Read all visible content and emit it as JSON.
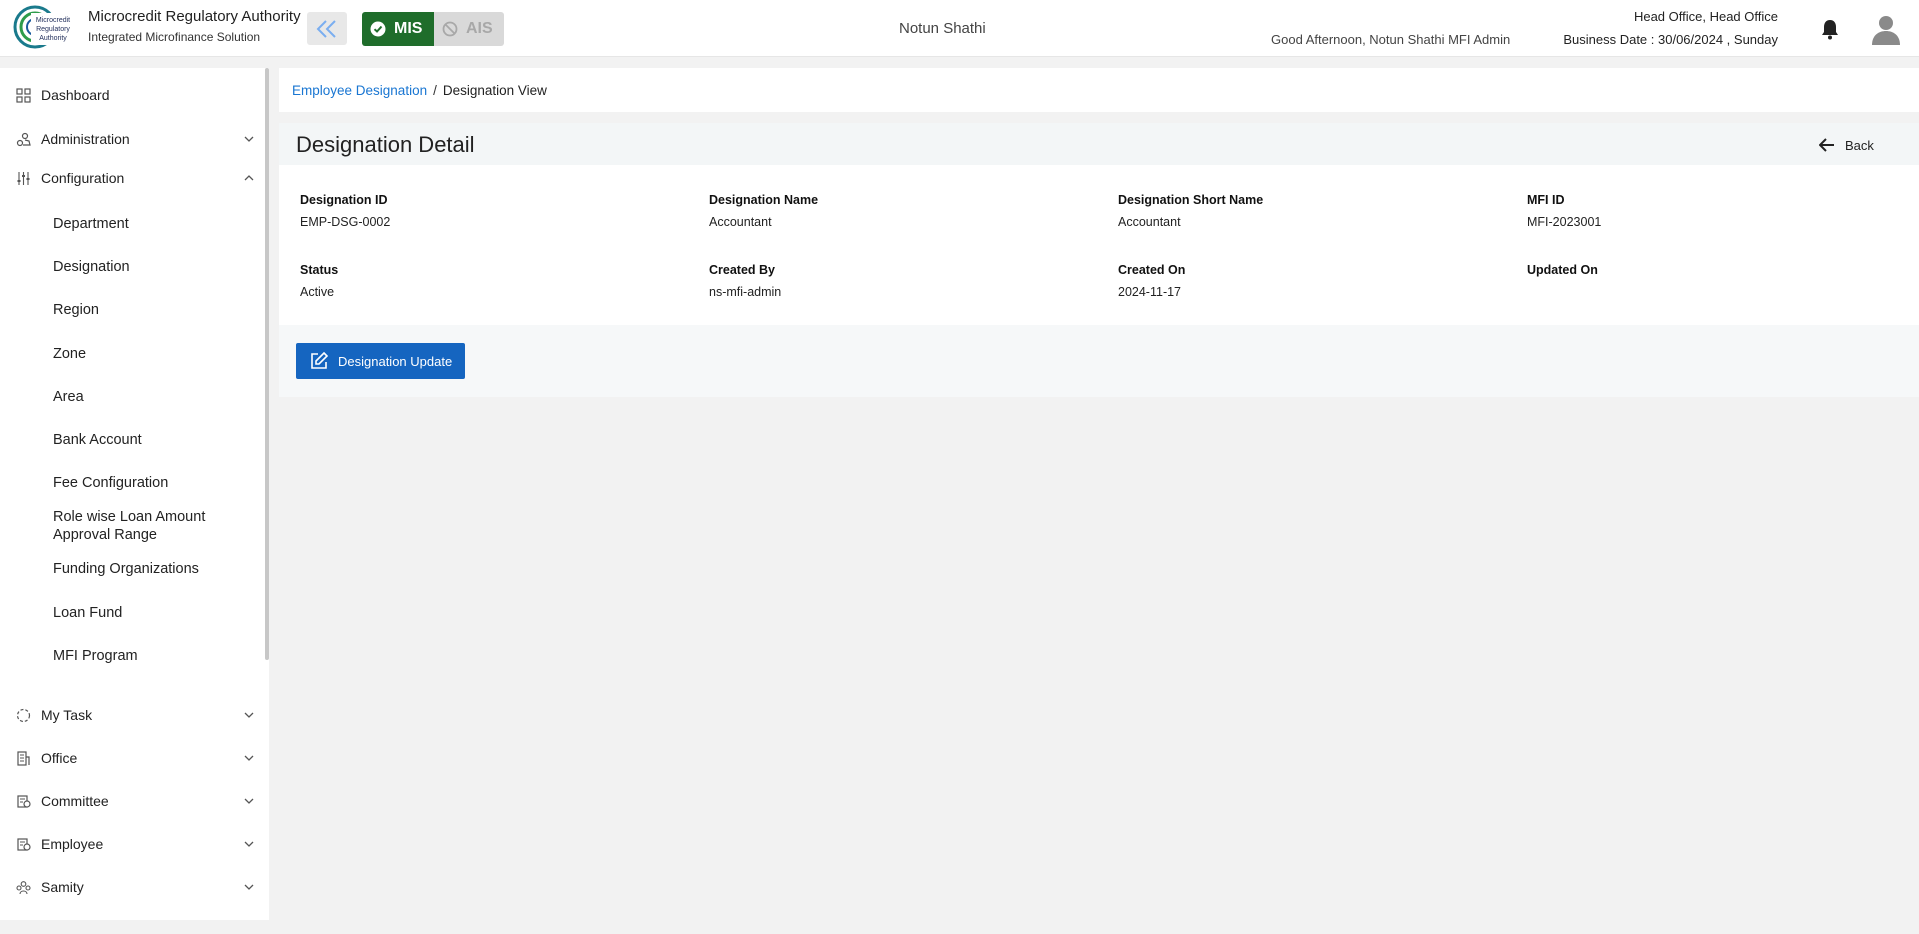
{
  "header": {
    "logo_text": [
      "Microcredit",
      "Regulatory",
      "Authority"
    ],
    "brand_title": "Microcredit Regulatory Authority",
    "brand_subtitle": "Integrated Microfinance Solution",
    "mis_label": "MIS",
    "ais_label": "AIS",
    "org_name": "Notun Shathi",
    "greeting": "Good Afternoon, Notun Shathi MFI Admin",
    "office": "Head Office, Head Office",
    "business_date": "Business Date : 30/06/2024 , Sunday",
    "colors": {
      "mis_active": "#1f6d2b",
      "ais_disabled": "#d9d9d9",
      "accent": "#1565c0"
    }
  },
  "sidebar": {
    "items": [
      {
        "label": "Dashboard",
        "icon": "grid-icon"
      },
      {
        "label": "Administration",
        "icon": "users-icon",
        "expandable": true
      },
      {
        "label": "Configuration",
        "icon": "sliders-icon",
        "expanded": true
      },
      {
        "label": "My Task",
        "icon": "spinner-icon",
        "expandable": true
      },
      {
        "label": "Office",
        "icon": "building-icon",
        "expandable": true
      },
      {
        "label": "Committee",
        "icon": "committee-icon",
        "expandable": true
      },
      {
        "label": "Employee",
        "icon": "employee-icon",
        "expandable": true
      },
      {
        "label": "Samity",
        "icon": "group-icon",
        "expandable": true
      }
    ],
    "config_children": [
      "Department",
      "Designation",
      "Region",
      "Zone",
      "Area",
      "Bank Account",
      "Fee Configuration",
      "Role wise Loan Amount Approval Range",
      "Funding Organizations",
      "Loan Fund",
      "MFI Program"
    ]
  },
  "breadcrumb": {
    "parent": "Employee Designation",
    "separator": "/",
    "current": "Designation View"
  },
  "detail": {
    "title": "Designation Detail",
    "back_label": "Back",
    "fields": [
      {
        "label": "Designation ID",
        "value": "EMP-DSG-0002"
      },
      {
        "label": "Designation Name",
        "value": "Accountant"
      },
      {
        "label": "Designation Short Name",
        "value": "Accountant"
      },
      {
        "label": "MFI ID",
        "value": "MFI-2023001"
      },
      {
        "label": "Status",
        "value": "Active"
      },
      {
        "label": "Created By",
        "value": "ns-mfi-admin"
      },
      {
        "label": "Created On",
        "value": "2024-11-17"
      },
      {
        "label": "Updated On",
        "value": ""
      }
    ],
    "update_label": "Designation Update"
  }
}
